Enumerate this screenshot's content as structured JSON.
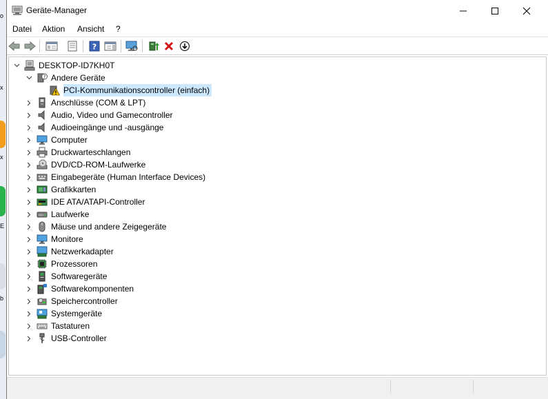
{
  "window": {
    "title": "Geräte-Manager"
  },
  "menu": [
    "Datei",
    "Aktion",
    "Ansicht",
    "?"
  ],
  "toolbar": [
    {
      "name": "back-button",
      "icon": "arrow-left-icon"
    },
    {
      "name": "forward-button",
      "icon": "arrow-right-icon"
    },
    {
      "name": "show-hide-console-tree-button",
      "icon": "console-tree-icon"
    },
    {
      "name": "properties-button",
      "icon": "properties-icon"
    },
    {
      "name": "help-button",
      "icon": "help-icon"
    },
    {
      "name": "action-pane-button",
      "icon": "action-pane-icon"
    },
    {
      "name": "scan-hardware-button",
      "icon": "monitor-scan-icon"
    },
    {
      "name": "update-driver-button",
      "icon": "update-driver-icon"
    },
    {
      "name": "uninstall-device-button",
      "icon": "red-x-icon"
    },
    {
      "name": "disable-device-button",
      "icon": "download-circle-icon"
    }
  ],
  "tree": {
    "root": "DESKTOP-ID7KH0T",
    "other": {
      "label": "Andere Geräte",
      "child": "PCI-Kommunikationscontroller (einfach)"
    },
    "categories": [
      {
        "label": "Anschlüsse (COM & LPT)",
        "icon": "port-icon"
      },
      {
        "label": "Audio, Video und Gamecontroller",
        "icon": "speaker-icon"
      },
      {
        "label": "Audioeingänge und -ausgänge",
        "icon": "speaker-icon"
      },
      {
        "label": "Computer",
        "icon": "computer-icon"
      },
      {
        "label": "Druckwarteschlangen",
        "icon": "printer-icon"
      },
      {
        "label": "DVD/CD-ROM-Laufwerke",
        "icon": "dvd-drive-icon"
      },
      {
        "label": "Eingabegeräte (Human Interface Devices)",
        "icon": "hid-icon"
      },
      {
        "label": "Grafikkarten",
        "icon": "display-adapter-icon"
      },
      {
        "label": "IDE ATA/ATAPI-Controller",
        "icon": "ide-controller-icon"
      },
      {
        "label": "Laufwerke",
        "icon": "disk-drive-icon"
      },
      {
        "label": "Mäuse und andere Zeigegeräte",
        "icon": "mouse-icon"
      },
      {
        "label": "Monitore",
        "icon": "monitor-icon"
      },
      {
        "label": "Netzwerkadapter",
        "icon": "network-adapter-icon"
      },
      {
        "label": "Prozessoren",
        "icon": "processor-icon"
      },
      {
        "label": "Softwaregeräte",
        "icon": "software-device-icon"
      },
      {
        "label": "Softwarekomponenten",
        "icon": "software-component-icon"
      },
      {
        "label": "Speichercontroller",
        "icon": "storage-controller-icon"
      },
      {
        "label": "Systemgeräte",
        "icon": "system-device-icon"
      },
      {
        "label": "Tastaturen",
        "icon": "keyboard-icon"
      },
      {
        "label": "USB-Controller",
        "icon": "usb-icon"
      }
    ]
  },
  "desktop_edge": [
    "o",
    "x",
    "x",
    "E",
    "b"
  ]
}
